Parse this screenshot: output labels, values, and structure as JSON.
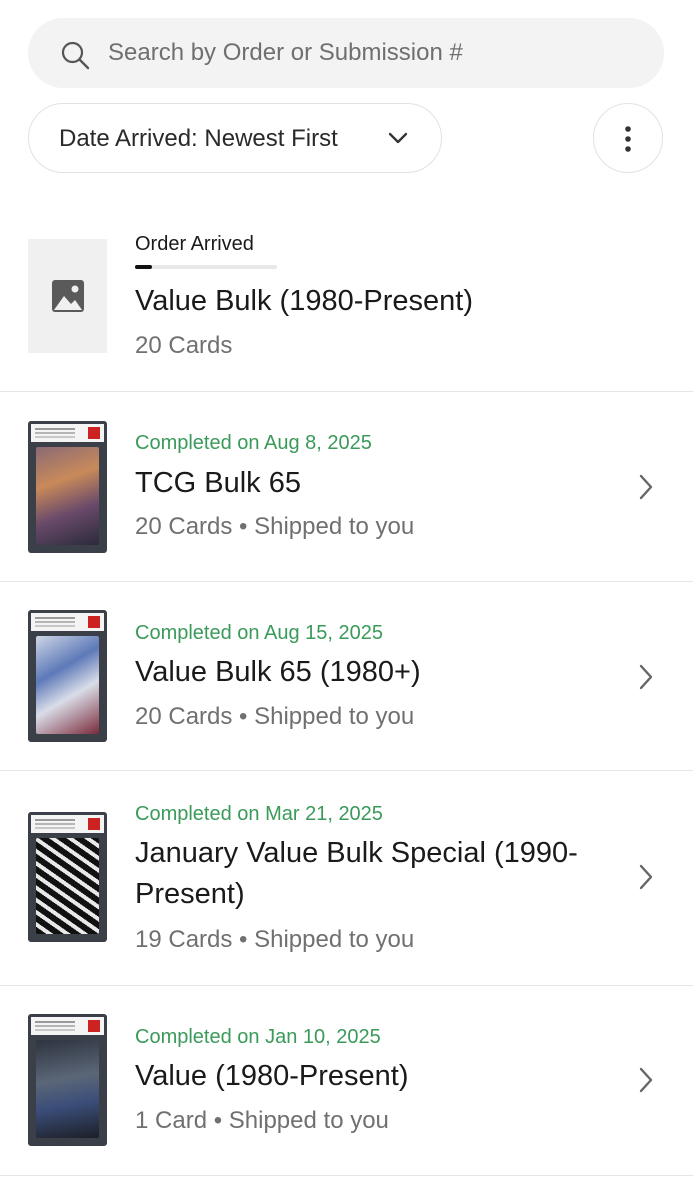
{
  "search": {
    "placeholder": "Search by Order or Submission #",
    "value": ""
  },
  "sort": {
    "label": "Date Arrived: Newest First"
  },
  "colors": {
    "completed_text": "#3a9a5a",
    "divider": "#e6e6e6",
    "progress": "#111111"
  },
  "orders": [
    {
      "status": "Order Arrived",
      "status_progress": 0.12,
      "title": "Value Bulk (1980-Present)",
      "meta": "20 Cards",
      "thumbnail": "image-placeholder-icon"
    },
    {
      "status": "Completed on Aug 8, 2025",
      "title": "TCG Bulk 65",
      "meta": "20 Cards • Shipped to you",
      "thumbnail": "graded-card-slab"
    },
    {
      "status": "Completed on Aug 15, 2025",
      "title": "Value Bulk 65 (1980+)",
      "meta": "20 Cards • Shipped to you",
      "thumbnail": "graded-card-slab"
    },
    {
      "status": "Completed on Mar 21, 2025",
      "title": "January Value Bulk Special (1990-Present)",
      "meta": "19 Cards • Shipped to you",
      "thumbnail": "graded-card-slab"
    },
    {
      "status": "Completed on Jan 10, 2025",
      "title": "Value (1980-Present)",
      "meta": "1 Card • Shipped to you",
      "thumbnail": "graded-card-slab"
    }
  ]
}
